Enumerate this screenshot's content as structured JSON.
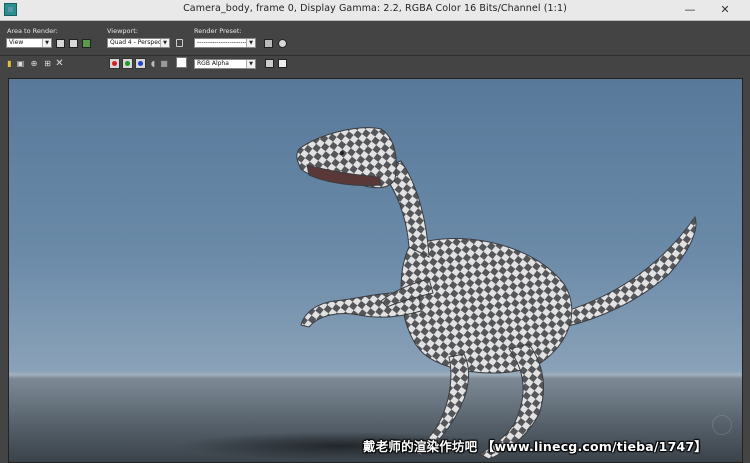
{
  "window": {
    "title": "Camera_body, frame 0, Display Gamma: 2.2, RGBA Color 16 Bits/Channel (1:1)",
    "minimize_glyph": "—",
    "close_glyph": "✕"
  },
  "toolbar": {
    "area_label": "Area to Render:",
    "area_value": "View",
    "viewport_label": "Viewport:",
    "viewport_value": "Quad 4 - Perspec",
    "preset_label": "Render Preset:",
    "preset_value": "------------------------",
    "channel_value": "RGB Alpha"
  },
  "icons": {
    "red_channel": "#d62020",
    "green_channel": "#1f9a2a",
    "blue_channel": "#2040d0"
  },
  "watermark": "戴老师的渲染作坊吧 【www.linecg.com/tieba/1747】"
}
